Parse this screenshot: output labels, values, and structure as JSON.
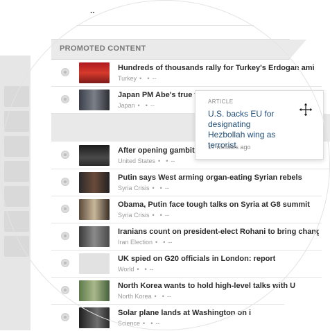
{
  "top_fragment": "..",
  "section": {
    "title": "PROMOTED CONTENT"
  },
  "popover": {
    "type": "ARTICLE",
    "title": "U.S. backs EU for designating Hezbollah wing as terrorist",
    "time": "17 minutes ago",
    "icon": "move-cursor-icon"
  },
  "rows": [
    {
      "headline": "Hundreds of thousands rally for Turkey's Erdogan ami",
      "category": "Turkey",
      "dash": "--"
    },
    {
      "headline": "Japan PM Abe's true tes",
      "category": "Japan",
      "dash": "--"
    },
    {
      "headline": "After opening gambit, I",
      "category": "United States",
      "dash": "--"
    },
    {
      "headline": "Putin says West arming organ-eating Syrian rebels",
      "category": "Syria Crisis",
      "dash": "--"
    },
    {
      "headline": "Obama, Putin face tough talks on Syria at G8 summit",
      "category": "Syria Crisis",
      "dash": "--"
    },
    {
      "headline": "Iranians count on president-elect Rohani to bring change",
      "category": "Iran Election",
      "dash": "--"
    },
    {
      "headline": "UK spied on G20 officials in London: report",
      "category": "World",
      "dash": "--"
    },
    {
      "headline": "North Korea wants to hold high-level talks with U",
      "category": "North Korea",
      "dash": "--"
    },
    {
      "headline": "Solar plane lands at Washington on i",
      "category": "Science",
      "dash": "--"
    }
  ],
  "colors": {
    "link": "#1f4b73",
    "header_bg": "#eaeaea"
  }
}
